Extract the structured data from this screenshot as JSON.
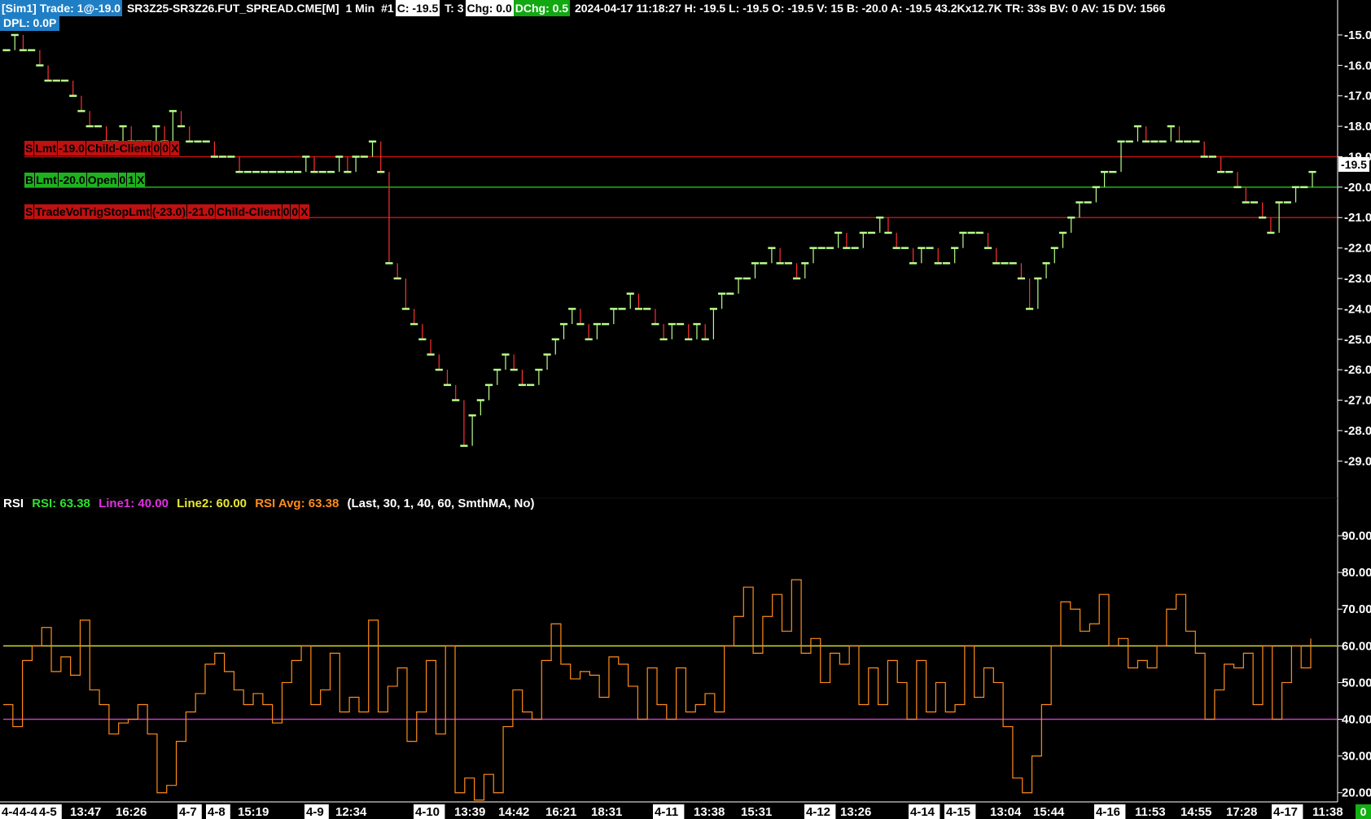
{
  "header": {
    "sim": "[Sim1]",
    "trade": "Trade: 1@-19.0",
    "symbol": "SR3Z25-SR3Z26.FUT_SPREAD.CME[M]",
    "interval": "1 Min",
    "chart_num": "#1",
    "close": "C: -19.5",
    "ticks": "T: 3",
    "chg": "Chg: 0.0",
    "dchg": "DChg: 0.5",
    "stats": "2024-04-17 11:18:27 H: -19.5 L: -19.5 O: -19.5 V: 15 B: -20.0 A: -19.5 43.2Kx12.7K TR: 33s BV: 0 AV: 15 DV: 1566"
  },
  "dpl": "DPL: 0.0P",
  "orders": [
    {
      "side_color": "red",
      "price": -19.0,
      "cells": [
        "S",
        "Lmt",
        "-19.0",
        "Child-Client",
        "0",
        "0",
        "X"
      ]
    },
    {
      "side_color": "green",
      "price": -20.0,
      "cells": [
        "B",
        "Lmt",
        "-20.0",
        "Open",
        "0",
        "1",
        "X"
      ]
    },
    {
      "side_color": "red",
      "price": -21.0,
      "cells": [
        "S",
        "TradeVolTrigStopLmt",
        "(-23.0)",
        "-21.0",
        "Child-Client",
        "0",
        "0",
        "X"
      ]
    }
  ],
  "current_price_label": "-19.5",
  "rsi_legend": {
    "name": "RSI",
    "rsi": "RSI: 63.38",
    "line1": "Line1: 40.00",
    "line2": "Line2: 60.00",
    "avg": "RSI Avg: 63.38",
    "params": "(Last, 30, 1, 40, 60, SmthMA, No)"
  },
  "colors": {
    "price_up": "#b8ff8a",
    "price_down": "#ff3030",
    "rsi": "#ff8c1a",
    "line1": "#c040c0",
    "line2": "#d6d62a",
    "order_red": "#c01010",
    "order_green": "#1db31d"
  },
  "bottom_badge": "0",
  "chart_data": [
    {
      "type": "line",
      "title": "SR3Z25-SR3Z26.FUT_SPREAD.CME[M] 1 Min",
      "ylim": [
        -29.5,
        -14.6
      ],
      "yticks": [
        "-15.0",
        "-16.0",
        "-17.0",
        "-18.0",
        "-19.0",
        "-20.0",
        "-21.0",
        "-22.0",
        "-23.0",
        "-24.0",
        "-25.0",
        "-26.0",
        "-27.0",
        "-28.0",
        "-29.0"
      ],
      "series": [
        {
          "values": [
            -15.5,
            -15.0,
            -15.5,
            -15.5,
            -16.0,
            -16.5,
            -16.5,
            -16.5,
            -17.0,
            -17.5,
            -18.0,
            -18.0,
            -18.5,
            -18.5,
            -18.0,
            -18.5,
            -18.5,
            -18.5,
            -18.0,
            -18.5,
            -17.5,
            -18.0,
            -18.5,
            -18.5,
            -18.5,
            -19.0,
            -19.0,
            -19.0,
            -19.5,
            -19.5,
            -19.5,
            -19.5,
            -19.5,
            -19.5,
            -19.5,
            -19.5,
            -19.0,
            -19.5,
            -19.5,
            -19.5,
            -19.0,
            -19.5,
            -19.0,
            -19.0,
            -18.5,
            -19.5,
            -22.5,
            -23.0,
            -24.0,
            -24.5,
            -25.0,
            -25.5,
            -26.0,
            -26.5,
            -27.0,
            -28.5,
            -27.5,
            -27.0,
            -26.5,
            -26.0,
            -25.5,
            -26.0,
            -26.5,
            -26.5,
            -26.0,
            -25.5,
            -25.0,
            -24.5,
            -24.0,
            -24.5,
            -25.0,
            -24.5,
            -24.5,
            -24.0,
            -24.0,
            -23.5,
            -24.0,
            -24.0,
            -24.5,
            -25.0,
            -24.5,
            -24.5,
            -25.0,
            -24.5,
            -25.0,
            -24.0,
            -23.5,
            -23.5,
            -23.0,
            -23.0,
            -22.5,
            -22.5,
            -22.0,
            -22.5,
            -22.5,
            -23.0,
            -22.5,
            -22.0,
            -22.0,
            -22.0,
            -21.5,
            -22.0,
            -22.0,
            -21.5,
            -21.5,
            -21.0,
            -21.5,
            -22.0,
            -22.0,
            -22.5,
            -22.0,
            -22.0,
            -22.5,
            -22.5,
            -22.0,
            -21.5,
            -21.5,
            -21.5,
            -22.0,
            -22.5,
            -22.5,
            -22.5,
            -23.0,
            -24.0,
            -23.0,
            -22.5,
            -22.0,
            -21.5,
            -21.0,
            -20.5,
            -20.5,
            -20.0,
            -19.5,
            -19.5,
            -18.5,
            -18.5,
            -18.0,
            -18.5,
            -18.5,
            -18.5,
            -18.0,
            -18.5,
            -18.5,
            -18.5,
            -19.0,
            -19.0,
            -19.5,
            -19.5,
            -20.0,
            -20.5,
            -20.5,
            -21.0,
            -21.5,
            -20.5,
            -20.5,
            -20.0,
            -20.0,
            -19.5
          ]
        }
      ],
      "order_lines": [
        -19.0,
        -20.0,
        -21.0
      ]
    },
    {
      "type": "line",
      "title": "RSI",
      "ylim": [
        17.5,
        94
      ],
      "yticks": [
        "20.00",
        "30.00",
        "40.00",
        "50.00",
        "60.00",
        "70.00",
        "80.00",
        "90.00"
      ],
      "series": [
        {
          "name": "RSI",
          "values": [
            44,
            38,
            56,
            60,
            65,
            53,
            57,
            52,
            67,
            48,
            44,
            36,
            39,
            40,
            44,
            36,
            20,
            22,
            34,
            42,
            47,
            55,
            58,
            53,
            48,
            44,
            47,
            44,
            39,
            50,
            56,
            60,
            44,
            48,
            58,
            42,
            46,
            42,
            67,
            42,
            49,
            54,
            34,
            42,
            56,
            36,
            60,
            20,
            24,
            18,
            25,
            20,
            38,
            48,
            42,
            40,
            56,
            66,
            55,
            51,
            53,
            52,
            46,
            57,
            55,
            49,
            40,
            54,
            44,
            40,
            54,
            42,
            44,
            47,
            42,
            60,
            68,
            76,
            58,
            68,
            74,
            64,
            78,
            58,
            62,
            50,
            58,
            55,
            60,
            44,
            54,
            44,
            56,
            50,
            40,
            56,
            42,
            50,
            42,
            44,
            60,
            46,
            54,
            50,
            38,
            24,
            20,
            30,
            44,
            60,
            72,
            70,
            64,
            66,
            74,
            60,
            62,
            54,
            56,
            54,
            60,
            70,
            74,
            64,
            58,
            40,
            48,
            55,
            54,
            58,
            44,
            60,
            40,
            50,
            60,
            54,
            62
          ]
        },
        {
          "name": "Line1",
          "values": [
            40,
            40
          ]
        },
        {
          "name": "Line2",
          "values": [
            60,
            60
          ]
        }
      ]
    }
  ],
  "xaxis": {
    "labels": [
      {
        "text": "4-4",
        "boxed": true
      },
      {
        "text": "4-4",
        "boxed": true
      },
      {
        "text": "4-5",
        "boxed": true
      },
      {
        "text": "13:47",
        "boxed": false
      },
      {
        "text": "16:26",
        "boxed": false
      },
      {
        "text": "4-7",
        "boxed": true
      },
      {
        "text": "4-8",
        "boxed": true
      },
      {
        "text": "15:19",
        "boxed": false
      },
      {
        "text": "4-9",
        "boxed": true
      },
      {
        "text": "12:34",
        "boxed": false
      },
      {
        "text": "4-10",
        "boxed": true
      },
      {
        "text": "13:39",
        "boxed": false
      },
      {
        "text": "14:42",
        "boxed": false
      },
      {
        "text": "16:21",
        "boxed": false
      },
      {
        "text": "18:31",
        "boxed": false
      },
      {
        "text": "4-11",
        "boxed": true
      },
      {
        "text": "13:38",
        "boxed": false
      },
      {
        "text": "15:31",
        "boxed": false
      },
      {
        "text": "4-12",
        "boxed": true
      },
      {
        "text": "13:26",
        "boxed": false
      },
      {
        "text": "4-14",
        "boxed": true
      },
      {
        "text": "4-15",
        "boxed": true
      },
      {
        "text": "13:04",
        "boxed": false
      },
      {
        "text": "15:44",
        "boxed": false
      },
      {
        "text": "4-16",
        "boxed": true
      },
      {
        "text": "11:53",
        "boxed": false
      },
      {
        "text": "14:55",
        "boxed": false
      },
      {
        "text": "17:28",
        "boxed": false
      },
      {
        "text": "4-17",
        "boxed": true
      },
      {
        "text": "11:38",
        "boxed": false
      }
    ]
  }
}
